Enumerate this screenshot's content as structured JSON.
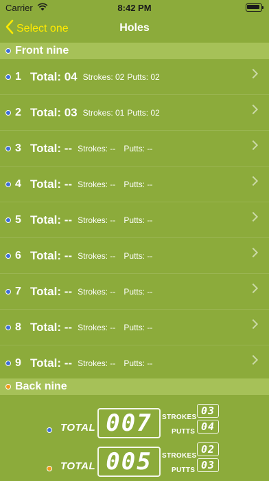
{
  "status_bar": {
    "carrier": "Carrier",
    "time": "8:42 PM"
  },
  "nav": {
    "back_label": "Select one",
    "title": "Holes"
  },
  "colors": {
    "background": "#8cab3b",
    "section_header": "#a6c158",
    "accent_yellow": "#ffea00",
    "dot_front": "#3f6fd9",
    "dot_back": "#f29a1a"
  },
  "sections": {
    "front": "Front nine",
    "back": "Back nine"
  },
  "holes": [
    {
      "number": "1",
      "total": "Total: 04",
      "strokes": "Strokes: 02",
      "putts": "Putts: 02"
    },
    {
      "number": "2",
      "total": "Total: 03",
      "strokes": "Strokes: 01",
      "putts": "Putts: 02"
    },
    {
      "number": "3",
      "total": "Total: --",
      "strokes": "Strokes: --",
      "putts": "Putts: --"
    },
    {
      "number": "4",
      "total": "Total: --",
      "strokes": "Strokes: --",
      "putts": "Putts: --"
    },
    {
      "number": "5",
      "total": "Total: --",
      "strokes": "Strokes: --",
      "putts": "Putts: --"
    },
    {
      "number": "6",
      "total": "Total: --",
      "strokes": "Strokes: --",
      "putts": "Putts: --"
    },
    {
      "number": "7",
      "total": "Total: --",
      "strokes": "Strokes: --",
      "putts": "Putts: --"
    },
    {
      "number": "8",
      "total": "Total: --",
      "strokes": "Strokes: --",
      "putts": "Putts: --"
    },
    {
      "number": "9",
      "total": "Total: --",
      "strokes": "Strokes: --",
      "putts": "Putts: --"
    }
  ],
  "summary": {
    "front": {
      "label": "TOTAL",
      "total": "007",
      "strokes_label": "STROKES",
      "strokes": "03",
      "putts_label": "PUTTS",
      "putts": "04"
    },
    "back": {
      "label": "TOTAL",
      "total": "005",
      "strokes_label": "STROKES",
      "strokes": "02",
      "putts_label": "PUTTS",
      "putts": "03"
    }
  }
}
